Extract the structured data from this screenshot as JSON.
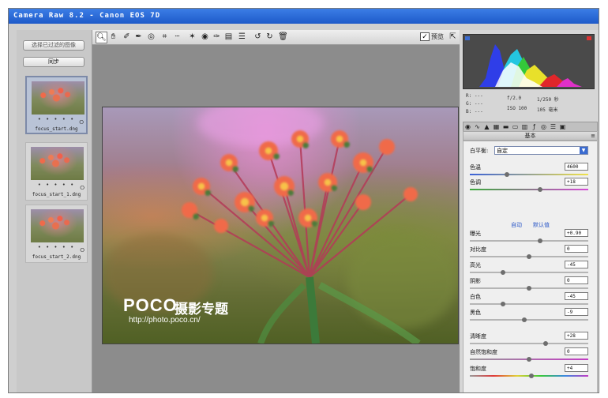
{
  "window": {
    "title": "Camera Raw 8.2 - Canon EOS 7D"
  },
  "filmstrip": {
    "select_filtered_button": "选择已过滤的图像",
    "sync_button": "同步",
    "items": [
      {
        "label": "focus_start.dng",
        "dots": "• • • • •",
        "selected": true
      },
      {
        "label": "focus_start_1.dng",
        "dots": "• • • • •",
        "selected": false
      },
      {
        "label": "focus_start_2.dng",
        "dots": "• • • • •",
        "selected": false
      }
    ]
  },
  "toolbar": {
    "tools": [
      "zoom-icon",
      "hand-icon",
      "white-balance-icon",
      "color-sampler-icon",
      "target-adjust-icon",
      "crop-icon",
      "straighten-icon",
      "spot-removal-icon",
      "red-eye-icon",
      "adjustment-brush-icon",
      "graduated-filter-icon",
      "radial-filter-icon",
      "preferences-icon",
      "rotate-ccw-icon",
      "rotate-cw-icon",
      "trash-icon"
    ],
    "preview_label": "预览",
    "preview_checked": true
  },
  "photo": {
    "watermark_logo": "POCO",
    "watermark_cn": "摄影专题",
    "watermark_url": "http://photo.poco.cn/"
  },
  "readout": {
    "r_label": "R:",
    "r_value": "---",
    "g_label": "G:",
    "g_value": "---",
    "b_label": "B:",
    "b_value": "---",
    "aperture": "f/2.0",
    "shutter": "1/250 秒",
    "iso": "ISO 100",
    "focal": "105 毫米"
  },
  "panel": {
    "section_title": "基本",
    "white_balance_label": "白平衡:",
    "white_balance_value": "自定",
    "auto_link": "自动",
    "default_link": "默认值",
    "sliders": [
      {
        "label": "色温",
        "value": "4600",
        "pos": 0.31
      },
      {
        "label": "色调",
        "value": "+18",
        "pos": 0.59
      },
      {
        "label": "曝光",
        "value": "+0.90",
        "pos": 0.59
      },
      {
        "label": "对比度",
        "value": "0",
        "pos": 0.5
      },
      {
        "label": "高光",
        "value": "-45",
        "pos": 0.28
      },
      {
        "label": "阴影",
        "value": "0",
        "pos": 0.5
      },
      {
        "label": "白色",
        "value": "-45",
        "pos": 0.28
      },
      {
        "label": "黑色",
        "value": "-9",
        "pos": 0.46
      },
      {
        "label": "清晰度",
        "value": "+28",
        "pos": 0.64
      },
      {
        "label": "自然饱和度",
        "value": "0",
        "pos": 0.5
      },
      {
        "label": "饱和度",
        "value": "+4",
        "pos": 0.52
      }
    ]
  },
  "colors": {
    "titlebar": "#1d59c9",
    "link": "#2a57c7"
  }
}
